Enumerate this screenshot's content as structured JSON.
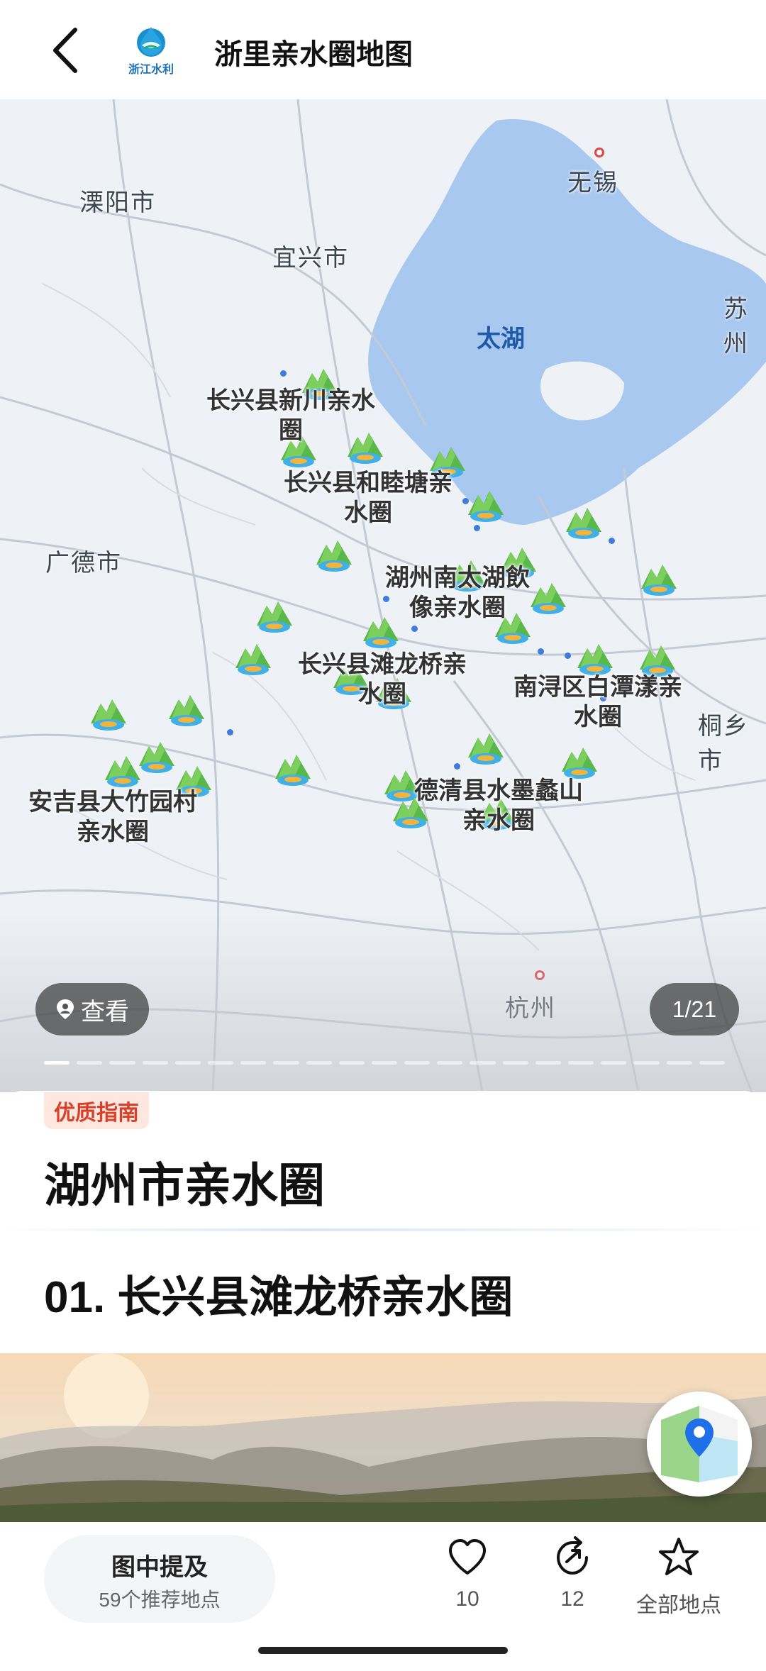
{
  "header": {
    "title": "浙里亲水圈地图",
    "logo_text": "浙江水利",
    "back_icon": "back-arrow-icon"
  },
  "map": {
    "cities": [
      "溧阳市",
      "宜兴市",
      "无锡",
      "苏州",
      "广德市",
      "桐乡市",
      "杭州"
    ],
    "lake": "太湖",
    "poi_labels": [
      "长兴县新川亲水圈",
      "长兴县和睦塘亲水圈",
      "湖州南太湖飲像亲水圈",
      "长兴县滩龙桥亲水圈",
      "南浔区白潭漾亲水圈",
      "安吉县大竹园村亲水圈",
      "德清县水墨蠡山亲水圈"
    ],
    "view_button": "查看",
    "counter": "1/21"
  },
  "content": {
    "tag": "优质指南",
    "title": "湖州市亲水圈",
    "subtitle": "01. 长兴县滩龙桥亲水圈"
  },
  "bottom": {
    "mention_title": "图中提及",
    "mention_sub": "59个推荐地点",
    "like_count": "10",
    "share_count": "12",
    "all_places": "全部地点"
  },
  "colors": {
    "accent_red": "#d8402a",
    "lake_blue": "#a8c8f0",
    "map_bg": "#eef1f5"
  }
}
